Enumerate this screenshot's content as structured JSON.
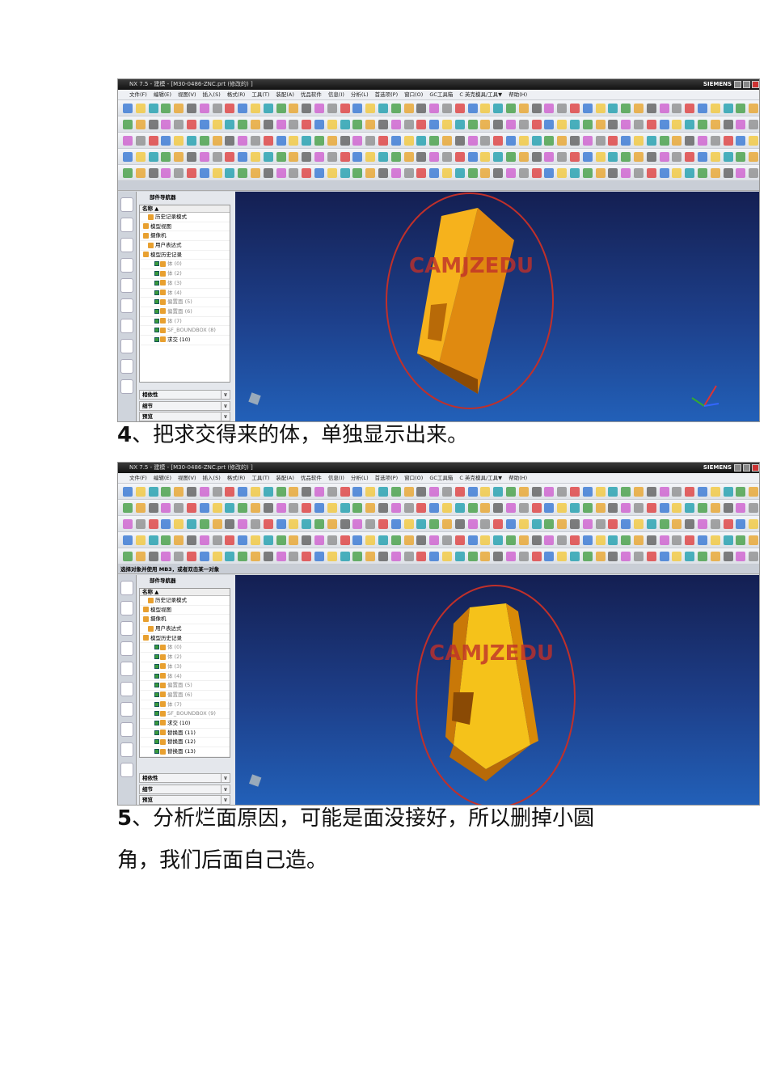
{
  "screens": [
    {
      "title": "NX 7.5 - 建模 - [M30-0486-ZNC.prt (修改的) ]",
      "brand": "SIEMENS",
      "menu": [
        "文件(F)",
        "编辑(E)",
        "视图(V)",
        "插入(S)",
        "格式(R)",
        "工具(T)",
        "装配(A)",
        "优品软件",
        "信息(I)",
        "分析(L)",
        "首选项(P)",
        "窗口(O)",
        "GC工具箱",
        "C 英克模具/工具▼",
        "帮助(H)"
      ],
      "status": "",
      "navigator": {
        "title": "部件导航器",
        "column": "名称 ▲",
        "items": [
          "历史记录模式",
          "模型视图",
          "摄像机",
          "用户表达式",
          "模型历史记录",
          "体 (0)",
          "体 (2)",
          "体 (3)",
          "体 (4)",
          "偏置面 (5)",
          "偏置面 (6)",
          "体 (7)",
          "SF_BOUNDBOX (8)",
          "求交 (10)"
        ],
        "panels": [
          "相依性",
          "细节",
          "预览"
        ]
      },
      "watermark": "CAMJZEDU"
    },
    {
      "title": "NX 7.5 - 建模 - [M30-0486-ZNC.prt (修改的) ]",
      "brand": "SIEMENS",
      "menu": [
        "文件(F)",
        "编辑(E)",
        "视图(V)",
        "插入(S)",
        "格式(R)",
        "工具(T)",
        "装配(A)",
        "优品软件",
        "信息(I)",
        "分析(L)",
        "首选项(P)",
        "窗口(O)",
        "GC工具箱",
        "C 英克模具/工具▼",
        "帮助(H)"
      ],
      "status": "选择对象并使用 MB3，或者双击某一对象",
      "navigator": {
        "title": "部件导航器",
        "column": "名称 ▲",
        "items": [
          "历史记录模式",
          "模型视图",
          "摄像机",
          "用户表达式",
          "模型历史记录",
          "体 (0)",
          "体 (2)",
          "体 (3)",
          "体 (4)",
          "偏置面 (5)",
          "偏置面 (6)",
          "体 (7)",
          "SF_BOUNDBOX (9)",
          "求交 (10)",
          "替换面 (11)",
          "替换面 (12)",
          "替换面 (13)"
        ],
        "panels": [
          "相依性",
          "细节",
          "预览"
        ]
      },
      "watermark": "CAMJZEDU"
    }
  ],
  "captions": {
    "c1_num": "4",
    "c1_text": "、把求交得来的体，单独显示出来。",
    "c2_num": "5",
    "c2_text": "、分析烂面原因，可能是面没接好，所以删掉小圆",
    "c2_line2": "角，我们后面自己造。"
  }
}
